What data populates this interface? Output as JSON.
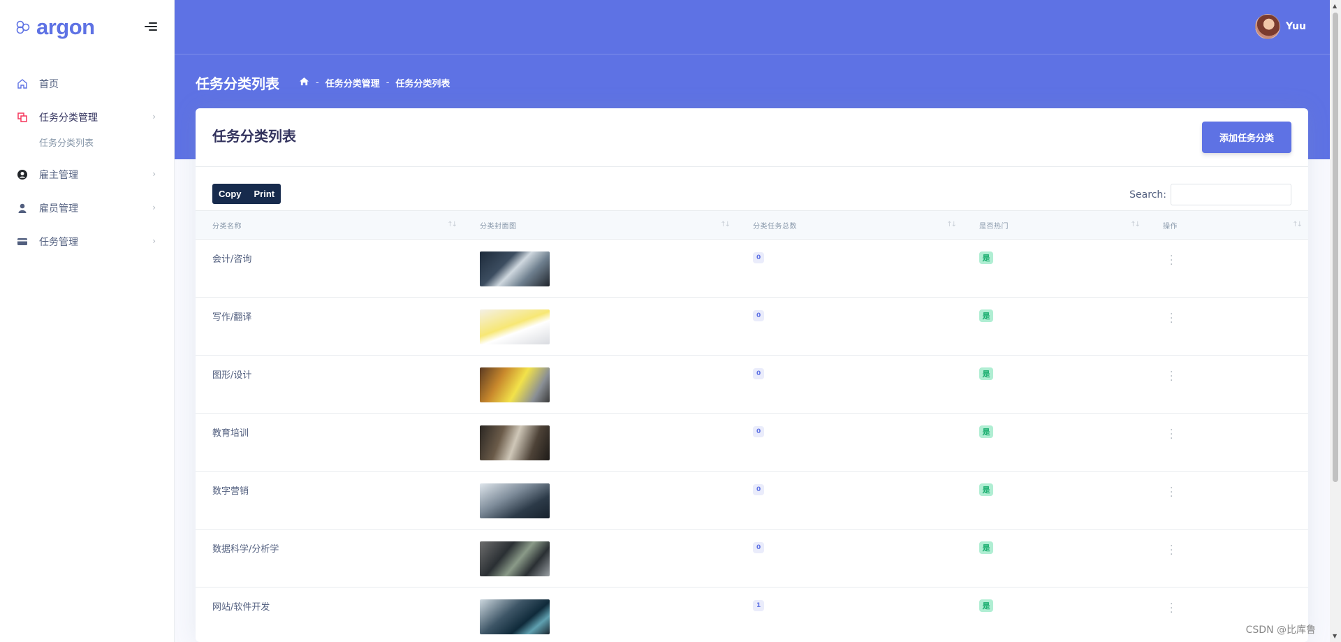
{
  "brand": {
    "name": "argon",
    "color": "#5e72e4"
  },
  "sidebar": {
    "items": [
      {
        "label": "首页",
        "icon": "house-icon",
        "has_chevron": false
      },
      {
        "label": "任务分类管理",
        "icon": "copy-icon",
        "has_chevron": true,
        "active": true,
        "subitems": [
          {
            "label": "任务分类列表"
          }
        ]
      },
      {
        "label": "雇主管理",
        "icon": "user-circle-icon",
        "has_chevron": true
      },
      {
        "label": "雇员管理",
        "icon": "user-icon",
        "has_chevron": true
      },
      {
        "label": "任务管理",
        "icon": "card-icon",
        "has_chevron": true
      }
    ]
  },
  "topbar": {
    "username": "Yuu"
  },
  "header": {
    "page_title": "任务分类列表",
    "breadcrumb": [
      "任务分类管理",
      "任务分类列表"
    ]
  },
  "card": {
    "title": "任务分类列表",
    "add_button": "添加任务分类",
    "export_buttons": [
      "Copy",
      "Print"
    ],
    "search_label": "Search:",
    "search_value": ""
  },
  "table": {
    "columns": [
      "分类名称",
      "分类封面图",
      "分类任务总数",
      "是否热门",
      "操作"
    ],
    "rows": [
      {
        "name": "会计/咨询",
        "cover": "handshake-photo",
        "task_count": "0",
        "hot": "是"
      },
      {
        "name": "写作/翻译",
        "cover": "keyboard-notebook-photo",
        "task_count": "0",
        "hot": "是"
      },
      {
        "name": "图形/设计",
        "cover": "designer-laptop-photo",
        "task_count": "0",
        "hot": "是"
      },
      {
        "name": "教育培训",
        "cover": "classroom-photo",
        "task_count": "0",
        "hot": "是"
      },
      {
        "name": "数字营销",
        "cover": "typing-laptop-photo",
        "task_count": "0",
        "hot": "是"
      },
      {
        "name": "数据科学/分析学",
        "cover": "dashboard-screens-photo",
        "task_count": "0",
        "hot": "是"
      },
      {
        "name": "网站/软件开发",
        "cover": "code-laptop-photo",
        "task_count": "1",
        "hot": "是"
      }
    ]
  },
  "watermark": "CSDN @比库鲁"
}
